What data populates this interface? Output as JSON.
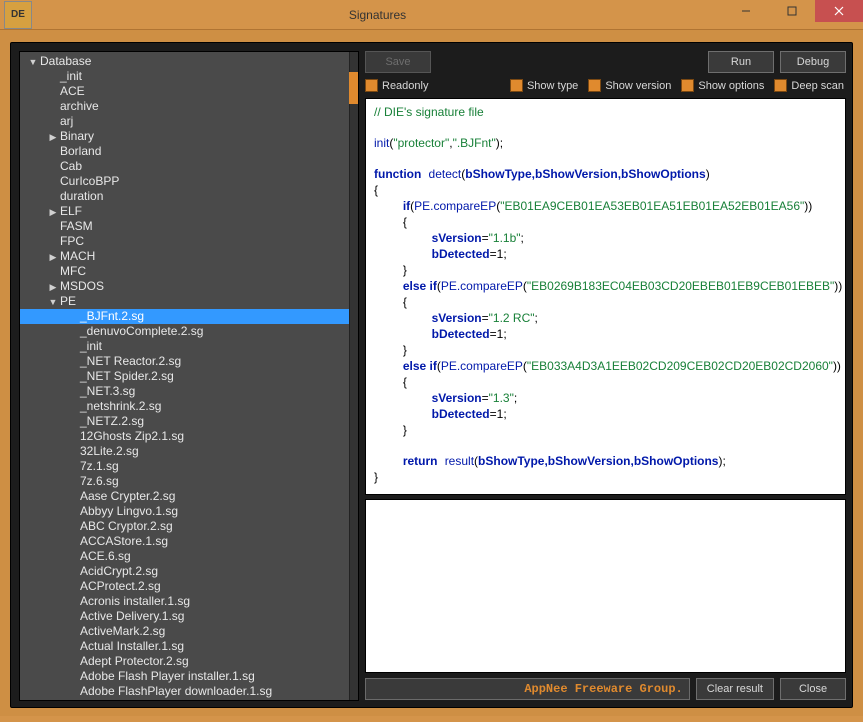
{
  "window": {
    "title": "Signatures",
    "icon_label": "DE"
  },
  "winbuttons": {
    "min": "–",
    "max": "☐",
    "close": "✕"
  },
  "toolbar": {
    "save": "Save",
    "run": "Run",
    "debug": "Debug"
  },
  "checks": {
    "readonly": "Readonly",
    "show_type": "Show type",
    "show_version": "Show version",
    "show_options": "Show options",
    "deep_scan": "Deep scan"
  },
  "tree": {
    "root_label": "Database",
    "top_items": [
      {
        "label": "_init",
        "indent": 1,
        "arrow": ""
      },
      {
        "label": "ACE",
        "indent": 1,
        "arrow": ""
      },
      {
        "label": "archive",
        "indent": 1,
        "arrow": ""
      },
      {
        "label": "arj",
        "indent": 1,
        "arrow": ""
      },
      {
        "label": "Binary",
        "indent": 1,
        "arrow": "▶"
      },
      {
        "label": "Borland",
        "indent": 1,
        "arrow": ""
      },
      {
        "label": "Cab",
        "indent": 1,
        "arrow": ""
      },
      {
        "label": "CurIcoBPP",
        "indent": 1,
        "arrow": ""
      },
      {
        "label": "duration",
        "indent": 1,
        "arrow": ""
      },
      {
        "label": "ELF",
        "indent": 1,
        "arrow": "▶"
      },
      {
        "label": "FASM",
        "indent": 1,
        "arrow": ""
      },
      {
        "label": "FPC",
        "indent": 1,
        "arrow": ""
      },
      {
        "label": "MACH",
        "indent": 1,
        "arrow": "▶"
      },
      {
        "label": "MFC",
        "indent": 1,
        "arrow": ""
      },
      {
        "label": "MSDOS",
        "indent": 1,
        "arrow": "▶"
      },
      {
        "label": "PE",
        "indent": 1,
        "arrow": "▼"
      }
    ],
    "pe_items": [
      "_BJFnt.2.sg",
      "_denuvoComplete.2.sg",
      "_init",
      "_NET Reactor.2.sg",
      "_NET Spider.2.sg",
      "_NET.3.sg",
      "_netshrink.2.sg",
      "_NETZ.2.sg",
      "12Ghosts Zip2.1.sg",
      "32Lite.2.sg",
      "7z.1.sg",
      "7z.6.sg",
      "Aase Crypter.2.sg",
      "Abbyy Lingvo.1.sg",
      "ABC Cryptor.2.sg",
      "ACCAStore.1.sg",
      "ACE.6.sg",
      "AcidCrypt.2.sg",
      "ACProtect.2.sg",
      "Acronis installer.1.sg",
      "Active Delivery.1.sg",
      "ActiveMark.2.sg",
      "Actual Installer.1.sg",
      "Adept Protector.2.sg",
      "Adobe Flash Player installer.1.sg",
      "Adobe FlashPlayer downloader.1.sg"
    ],
    "selected_index": 0
  },
  "code": {
    "comment": "// DIE's signature file",
    "init_fn": "init",
    "init_arg1": "\"protector\"",
    "init_arg2": "\".BJFnt\"",
    "kw_function": "function",
    "detect_name": "detect",
    "detect_params": "bShowType,bShowVersion,bShowOptions",
    "kw_if": "if",
    "kw_elseif": "else if",
    "compare_call": "PE.compareEP",
    "ep1": "\"EB01EA9CEB01EA53EB01EA51EB01EA52EB01EA56\"",
    "ep2": "\"EB0269B183EC04EB03CD20EBEB01EB9CEB01EBEB\"",
    "ep3": "\"EB033A4D3A1EEB02CD209CEB02CD20EB02CD2060\"",
    "sver": "sVersion",
    "bdet": "bDetected",
    "v1": "\"1.1b\"",
    "v2": "\"1.2 RC\"",
    "v3": "\"1.3\"",
    "one": "1",
    "kw_return": "return",
    "result_call": "result",
    "result_args": "bShowType,bShowVersion,bShowOptions"
  },
  "footer": {
    "watermark": "AppNee Freeware Group.",
    "clear": "Clear result",
    "close": "Close"
  },
  "colors": {
    "frame": "#ce8f44",
    "body": "#1c1c1c",
    "accent": "#e08a2e",
    "select": "#3399ff"
  }
}
